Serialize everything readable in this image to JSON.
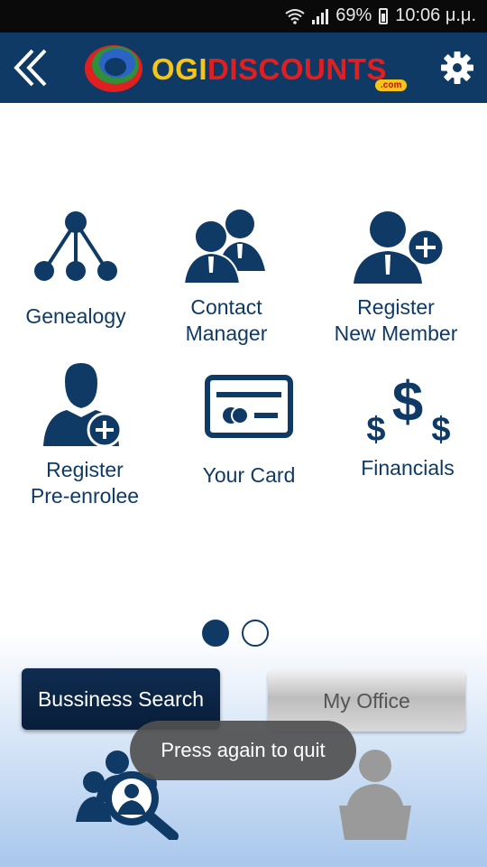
{
  "status_bar": {
    "battery": "69%",
    "time": "10:06 μ.μ."
  },
  "app_bar": {
    "logo": {
      "part1": "OGI",
      "part2": "DISCOUNTS",
      "suffix": ".com"
    },
    "back_icon": "double-chevron-left",
    "settings_icon": "gear"
  },
  "menu": {
    "items": [
      {
        "label_line1": "Genealogy",
        "label_line2": "",
        "icon": "genealogy-tree"
      },
      {
        "label_line1": "Contact",
        "label_line2": "Manager",
        "icon": "contacts-people"
      },
      {
        "label_line1": "Register",
        "label_line2": "New Member",
        "icon": "add-user"
      },
      {
        "label_line1": "Register",
        "label_line2": "Pre-enrolee",
        "icon": "add-person"
      },
      {
        "label_line1": "Your Card",
        "label_line2": "",
        "icon": "card"
      },
      {
        "label_line1": "Financials",
        "label_line2": "",
        "icon": "dollar-signs"
      }
    ]
  },
  "pager": {
    "pages": 2,
    "active": 1
  },
  "buttons": {
    "business_search": "Bussiness Search",
    "my_office": "My Office"
  },
  "toast": "Press again to quit",
  "colors": {
    "primary": "#0f3a66",
    "status_bar": "#0a0a0a",
    "logo_yellow": "#f5c518",
    "logo_red": "#e02020"
  }
}
